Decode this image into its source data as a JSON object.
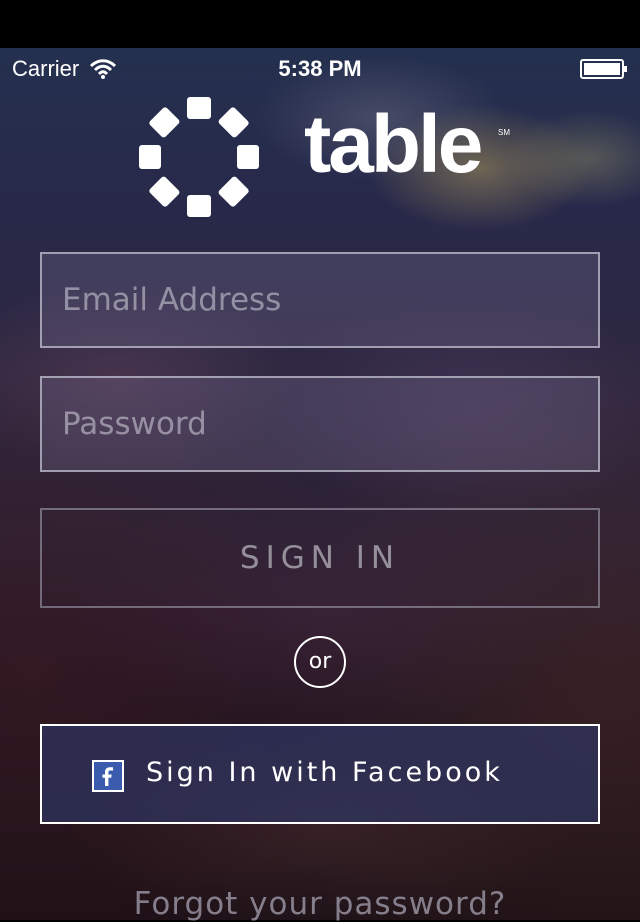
{
  "status_bar": {
    "carrier": "Carrier",
    "time": "5:38 PM"
  },
  "logo": {
    "name": "table",
    "trademark": "SM"
  },
  "form": {
    "email_placeholder": "Email Address",
    "password_placeholder": "Password",
    "signin_label": "SIGN IN",
    "or_label": "or",
    "facebook_label": "Sign In with Facebook",
    "forgot_password": "Forgot your password?"
  },
  "icons": {
    "wifi": "wifi-icon",
    "battery": "battery-icon",
    "facebook": "facebook-icon",
    "logo_mark": "gear-logo-icon"
  },
  "colors": {
    "facebook_button": "#2e3a6c",
    "field_border": "#cdd0dc",
    "text": "#ffffff"
  }
}
